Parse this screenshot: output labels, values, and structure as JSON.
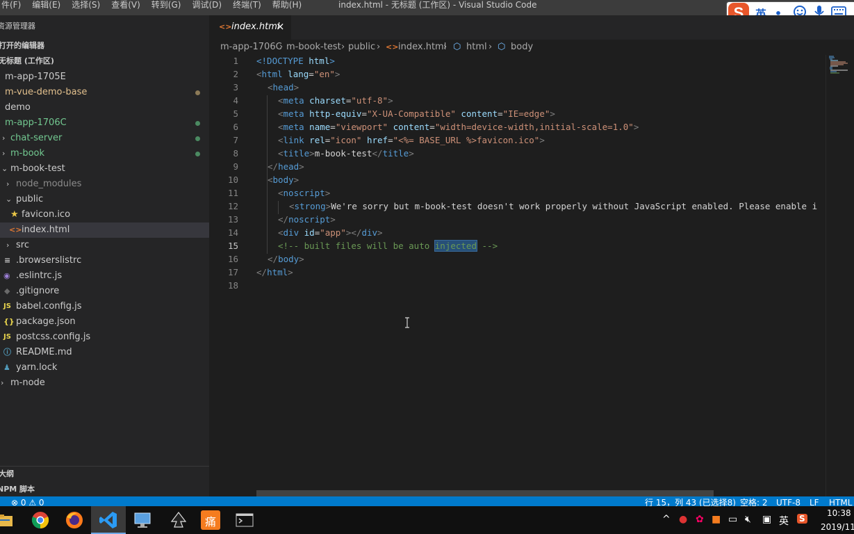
{
  "menu": [
    "件(F)",
    "编辑(E)",
    "选择(S)",
    "查看(V)",
    "转到(G)",
    "调试(D)",
    "终端(T)",
    "帮助(H)"
  ],
  "window_title": "index.html - 无标题 (工作区) - Visual Studio Code",
  "ime": {
    "logo": "S",
    "mode": "英",
    "punct": "•,"
  },
  "sidebar": {
    "title": "资源管理器",
    "open_editors": "打开的编辑器",
    "workspace": "无标题 (工作区)",
    "items": [
      {
        "label": "m-app-1705E",
        "color": "#cccccc"
      },
      {
        "label": "m-vue-demo-base",
        "color": "#e2c08d"
      },
      {
        "label": "demo",
        "color": "#cccccc"
      },
      {
        "label": "m-app-1706C",
        "color": "#73c991"
      },
      {
        "label": "chat-server",
        "color": "#73c991"
      },
      {
        "label": "m-book",
        "color": "#73c991"
      },
      {
        "label": "m-book-test",
        "color": "#cccccc"
      },
      {
        "label": "node_modules",
        "color": "#8c8c8c"
      },
      {
        "label": "public",
        "color": "#cccccc"
      },
      {
        "label": "favicon.ico",
        "color": "#cccccc"
      },
      {
        "label": "index.html",
        "color": "#cccccc"
      },
      {
        "label": "src",
        "color": "#cccccc"
      },
      {
        "label": ".browserslistrc",
        "color": "#cccccc"
      },
      {
        "label": ".eslintrc.js",
        "color": "#cccccc"
      },
      {
        "label": ".gitignore",
        "color": "#cccccc"
      },
      {
        "label": "babel.config.js",
        "color": "#cccccc"
      },
      {
        "label": "package.json",
        "color": "#cccccc"
      },
      {
        "label": "postcss.config.js",
        "color": "#cccccc"
      },
      {
        "label": "README.md",
        "color": "#cccccc"
      },
      {
        "label": "yarn.lock",
        "color": "#cccccc"
      },
      {
        "label": "m-node",
        "color": "#cccccc"
      }
    ],
    "outline": "大纲",
    "npm": "NPM 脚本"
  },
  "tab": {
    "label": "index.html",
    "close": "×"
  },
  "breadcrumb": [
    "m-app-1706C",
    "m-book-test",
    "public",
    "index.html",
    "html",
    "body"
  ],
  "code": {
    "line_numbers": [
      "1",
      "2",
      "3",
      "4",
      "5",
      "6",
      "7",
      "8",
      "9",
      "10",
      "11",
      "12",
      "13",
      "14",
      "15",
      "16",
      "17",
      "18"
    ],
    "l1": [
      "<!DOCTYPE",
      " html",
      ">"
    ],
    "l2": [
      "<",
      "html",
      " lang",
      "=",
      "\"en\"",
      ">"
    ],
    "l3": [
      "<",
      "head",
      ">"
    ],
    "l4": [
      "<",
      "meta",
      " charset",
      "=",
      "\"utf-8\"",
      ">"
    ],
    "l5": [
      "<",
      "meta",
      " http-equiv",
      "=",
      "\"X-UA-Compatible\"",
      " content",
      "=",
      "\"IE=edge\"",
      ">"
    ],
    "l6": [
      "<",
      "meta",
      " name",
      "=",
      "\"viewport\"",
      " content",
      "=",
      "\"width=device-width,initial-scale=1.0\"",
      ">"
    ],
    "l7": [
      "<",
      "link",
      " rel",
      "=",
      "\"icon\"",
      " href",
      "=",
      "\"<%= BASE_URL %>favicon.ico\"",
      ">"
    ],
    "l8": [
      "<",
      "title",
      ">",
      "m-book-test",
      "</",
      "title",
      ">"
    ],
    "l9": [
      "</",
      "head",
      ">"
    ],
    "l10": [
      "<",
      "body",
      ">"
    ],
    "l11": [
      "<",
      "noscript",
      ">"
    ],
    "l12": [
      "<",
      "strong",
      ">",
      "We're sorry but m-book-test doesn't work properly without JavaScript enabled. Please enable i"
    ],
    "l13": [
      "</",
      "noscript",
      ">"
    ],
    "l14": [
      "<",
      "div",
      " id",
      "=",
      "\"app\"",
      "></",
      "div",
      ">"
    ],
    "l15": [
      "<!-- built files will be auto ",
      "injected",
      " -->"
    ],
    "l16": [
      "</",
      "body",
      ">"
    ],
    "l17": [
      "</",
      "html",
      ">"
    ]
  },
  "status": {
    "left": "⊗ 0  ⚠ 0",
    "position": "行 15，列 43 (已选择8)",
    "spaces": "空格: 2",
    "encoding": "UTF-8",
    "eol": "LF",
    "lang": "HTML"
  },
  "taskbar": {
    "tray_ime": "英",
    "tray_s": "S",
    "clock_time": "10:38",
    "clock_date": "2019/11,",
    "app_num": "痛"
  },
  "colors": {
    "accent": "#007acc",
    "selection": "#264f78"
  }
}
